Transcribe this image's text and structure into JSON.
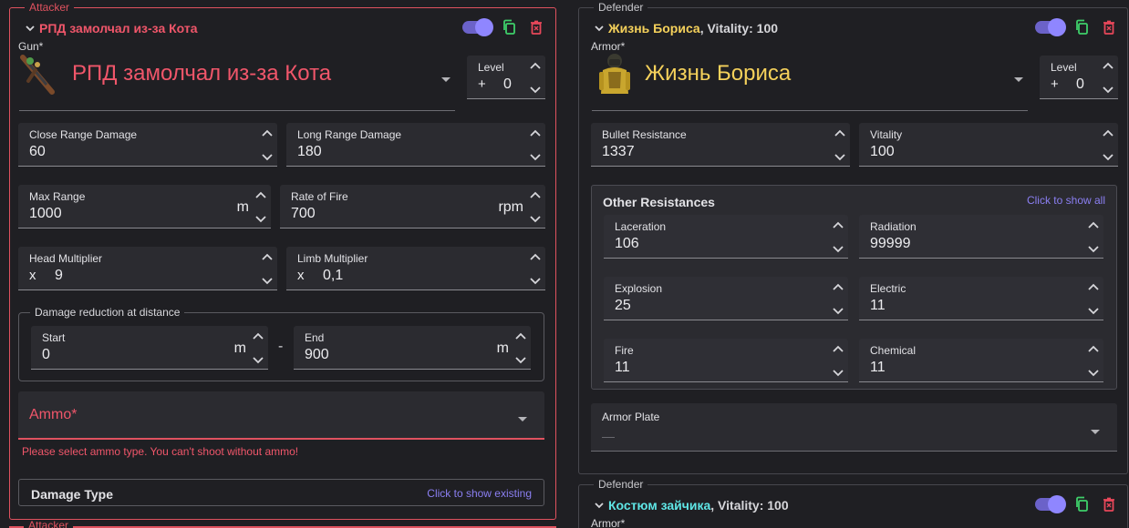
{
  "icons": {
    "chevron": "chevron-down-icon",
    "copy": "copy-icon",
    "delete": "trash-icon",
    "dropdown": "triangle-down-icon",
    "spin": "chevron-up-down-icon"
  },
  "colors": {
    "attacker": "#e0525f",
    "accent": "#8f86ff",
    "copy": "#3ecf6a",
    "danger": "#e8475a"
  },
  "attacker": {
    "legend": "Attacker",
    "title": "РПД замолчал из-за Кота",
    "enabled": true,
    "gun_label": "Gun*",
    "gun_name": "РПД замолчал из-за Кота",
    "level": {
      "label": "Level",
      "prefix": "+",
      "value": "0"
    },
    "close_range_damage": {
      "label": "Close Range Damage",
      "value": "60"
    },
    "long_range_damage": {
      "label": "Long Range Damage",
      "value": "180"
    },
    "max_range": {
      "label": "Max Range",
      "value": "1000",
      "unit": "m"
    },
    "rate_of_fire": {
      "label": "Rate of Fire",
      "value": "700",
      "unit": "rpm"
    },
    "head_multiplier": {
      "label": "Head Multiplier",
      "prefix": "x",
      "value": "9"
    },
    "limb_multiplier": {
      "label": "Limb Multiplier",
      "prefix": "x",
      "value": "0,1"
    },
    "damage_reduction": {
      "label": "Damage reduction at distance",
      "start": {
        "label": "Start",
        "value": "0",
        "unit": "m"
      },
      "separator": "-",
      "end": {
        "label": "End",
        "value": "900",
        "unit": "m"
      }
    },
    "ammo": {
      "label": "Ammo*",
      "error": "Please select ammo type. You can't shoot without ammo!"
    },
    "damage_type": {
      "label": "Damage Type",
      "link": "Click to show existing"
    }
  },
  "attacker2": {
    "legend": "Attacker"
  },
  "defender": {
    "legend": "Defender",
    "title": "Жизнь Бориса",
    "title_suffix": ", Vitality: 100",
    "enabled": true,
    "armor_label": "Armor*",
    "armor_name": "Жизнь Бориса",
    "level": {
      "label": "Level",
      "prefix": "+",
      "value": "0"
    },
    "bullet_resistance": {
      "label": "Bullet Resistance",
      "value": "1337"
    },
    "vitality": {
      "label": "Vitality",
      "value": "100"
    },
    "other_resistances": {
      "title": "Other Resistances",
      "link": "Click to show all",
      "laceration": {
        "label": "Laceration",
        "value": "106"
      },
      "radiation": {
        "label": "Radiation",
        "value": "99999"
      },
      "explosion": {
        "label": "Explosion",
        "value": "25"
      },
      "electric": {
        "label": "Electric",
        "value": "11"
      },
      "fire": {
        "label": "Fire",
        "value": "11"
      },
      "chemical": {
        "label": "Chemical",
        "value": "11"
      }
    },
    "armor_plate": {
      "label": "Armor Plate",
      "value": "—"
    }
  },
  "defender2": {
    "legend": "Defender",
    "title": "Костюм зайчика",
    "title_suffix": ", Vitality: 100",
    "enabled": true,
    "armor_label": "Armor*"
  }
}
